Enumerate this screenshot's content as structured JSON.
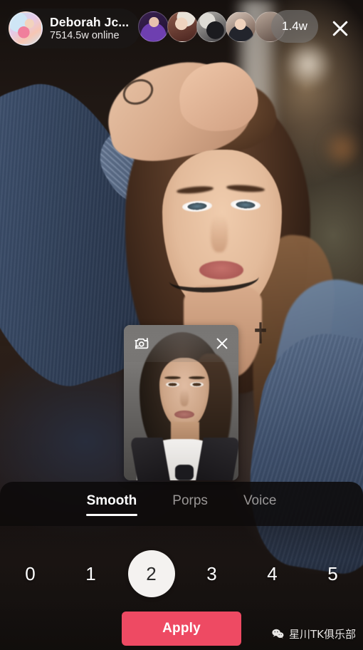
{
  "topbar": {
    "host": {
      "name": "Deborah Jc...",
      "online": "7514.5w online",
      "avatar_icon": "user-avatar-illustration"
    },
    "viewers": [
      {
        "id": "viewer-1"
      },
      {
        "id": "viewer-2"
      },
      {
        "id": "viewer-3"
      },
      {
        "id": "viewer-4"
      },
      {
        "id": "viewer-5"
      }
    ],
    "viewer_count": "1.4w",
    "close_icon": "close-icon"
  },
  "pip": {
    "flip_camera_icon": "camera-flip-icon",
    "close_icon": "close-icon"
  },
  "panel": {
    "tabs": [
      {
        "label": "Smooth",
        "active": true
      },
      {
        "label": "Porps",
        "active": false
      },
      {
        "label": "Voice",
        "active": false
      }
    ],
    "levels": [
      "0",
      "1",
      "2",
      "3",
      "4",
      "5"
    ],
    "selected_level": "2",
    "apply_label": "Apply"
  },
  "watermark": {
    "icon": "wechat-icon",
    "text": "星川TK俱乐部"
  },
  "colors": {
    "accent": "#ee4a63",
    "panel_dark": "#0c0a0a",
    "active_tab": "#ffffff",
    "inactive_tab": "#9e9b99",
    "selected_knob": "#f4f2f0"
  }
}
